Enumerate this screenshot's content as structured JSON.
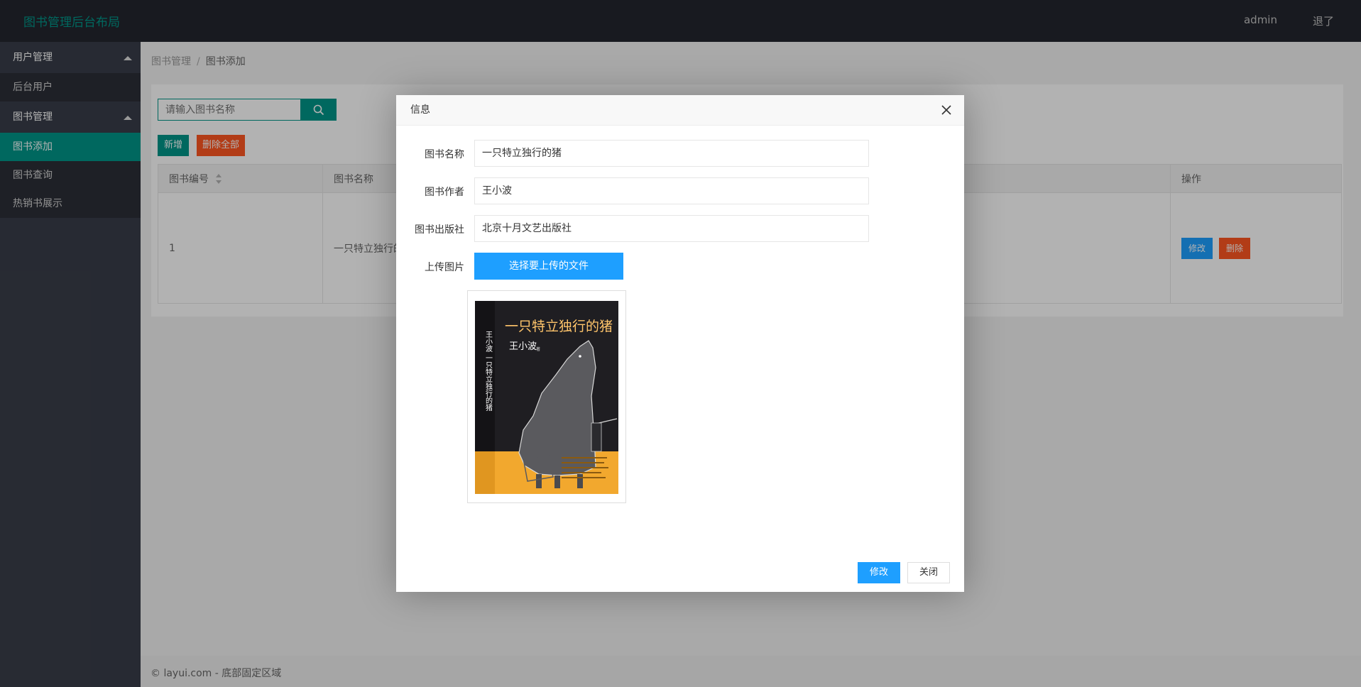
{
  "header": {
    "logo": "图书管理后台布局",
    "user": "admin",
    "logout": "退了"
  },
  "sidebar": {
    "groups": [
      {
        "label": "用户管理",
        "items": [
          {
            "label": "后台用户"
          }
        ]
      },
      {
        "label": "图书管理",
        "items": [
          {
            "label": "图书添加"
          },
          {
            "label": "图书查询"
          },
          {
            "label": "热销书展示"
          }
        ]
      }
    ]
  },
  "breadcrumb": {
    "parent": "图书管理",
    "separator": "/",
    "current": "图书添加"
  },
  "search": {
    "placeholder": "请输入图书名称"
  },
  "toolbar": {
    "add_label": "新增",
    "delete_all_label": "删除全部"
  },
  "table": {
    "headers": [
      "图书编号",
      "图书名称",
      "操作"
    ],
    "rows": [
      {
        "id": "1",
        "name": "一只特立独行的猪",
        "edit": "修改",
        "delete": "删除"
      }
    ]
  },
  "footer": {
    "text": "© layui.com - 底部固定区域"
  },
  "modal": {
    "title": "信息",
    "fields": [
      {
        "label": "图书名称",
        "value": "一只特立独行的猪"
      },
      {
        "label": "图书作者",
        "value": "王小波"
      },
      {
        "label": "图书出版社",
        "value": "北京十月文艺出版社"
      }
    ],
    "upload_label": "上传图片",
    "upload_button": "选择要上传的文件",
    "book_cover": {
      "title": "一只特立独行的猪",
      "author": "王小波",
      "author_mark": "著",
      "spine": "王小波 一只特立独行的猪"
    },
    "confirm": "修改",
    "close": "关闭"
  },
  "colors": {
    "primary": "#009688",
    "blue": "#1e9fff",
    "danger": "#ff5722",
    "header": "#23262e",
    "sidebar": "#393d49"
  }
}
